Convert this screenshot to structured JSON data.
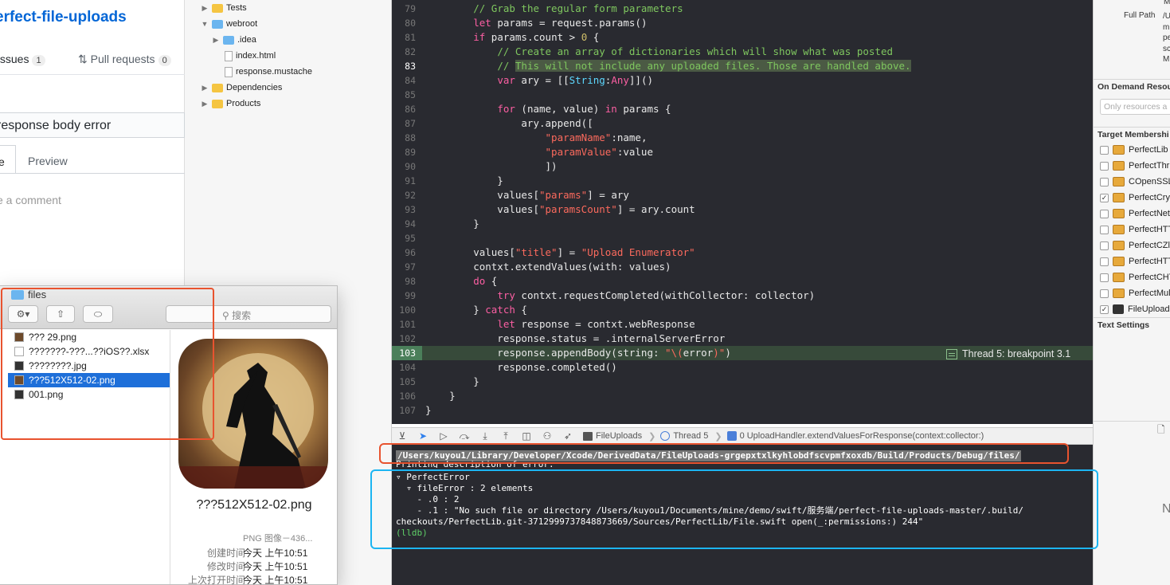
{
  "github": {
    "repo_title": "erfect-file-uploads",
    "issues_label": "Issues",
    "issues_count": "1",
    "pr_label": "Pull requests",
    "pr_count": "0",
    "issue_title": "response body error",
    "write_tab": "e",
    "preview_tab": "Preview",
    "comment_placeholder": "e a comment"
  },
  "navigator": {
    "items": [
      {
        "label": "Tests",
        "kind": "folder"
      },
      {
        "label": "webroot",
        "kind": "folder-blue"
      },
      {
        "label": ".idea",
        "kind": "folder-blue"
      },
      {
        "label": "index.html",
        "kind": "file"
      },
      {
        "label": "response.mustache",
        "kind": "file"
      },
      {
        "label": "Dependencies",
        "kind": "folder"
      },
      {
        "label": "Products",
        "kind": "folder"
      }
    ]
  },
  "editor": {
    "line_numbers": [
      "79",
      "80",
      "81",
      "82",
      "83",
      "84",
      "85",
      "86",
      "87",
      "88",
      "89",
      "90",
      "91",
      "92",
      "93",
      "94",
      "95",
      "96",
      "97",
      "98",
      "99",
      "100",
      "101",
      "102",
      "103",
      "104",
      "105",
      "106",
      "107"
    ],
    "breakpoint_label": "Thread 5: breakpoint 3.1"
  },
  "debugbar": {
    "crumb_target": "FileUploads",
    "crumb_thread": "Thread 5",
    "crumb_frame": "0 UploadHandler.extendValuesForResponse(context:collector:)"
  },
  "console": {
    "path_line": "/Users/kuyou1/Library/Developer/Xcode/DerivedData/FileUploads-grgepxtxlkyhlobdfscvpmfxoxdb/Build/Products/Debug/files/",
    "printing_line": "Printing description of error:",
    "line1": "▿ PerfectError",
    "line2": "  ▿ fileError : 2 elements",
    "line3": "    - .0 : 2",
    "line4": "    - .1 : \"No such file or directory /Users/kuyou1/Documents/mine/demo/swift/服务端/perfect-file-uploads-master/.build/",
    "line5": "checkouts/PerfectLib.git-3712999737848873669/Sources/PerfectLib/File.swift open(_:permissions:) 244\"",
    "prompt": "(lldb)"
  },
  "inspector": {
    "top_value_1": "M",
    "full_path_label": "Full Path",
    "full_path_lines": [
      "/U",
      "m",
      "pe",
      "sc",
      "M"
    ],
    "on_demand_title": "On Demand Resou",
    "on_demand_placeholder": "Only resources a",
    "target_membership_title": "Target Membershi",
    "targets": [
      {
        "label": "PerfectLib",
        "checked": false,
        "icon": "briefcase"
      },
      {
        "label": "PerfectThr",
        "checked": false,
        "icon": "briefcase"
      },
      {
        "label": "COpenSSL",
        "checked": false,
        "icon": "briefcase"
      },
      {
        "label": "PerfectCry",
        "checked": true,
        "icon": "briefcase"
      },
      {
        "label": "PerfectNet",
        "checked": false,
        "icon": "briefcase"
      },
      {
        "label": "PerfectHTT",
        "checked": false,
        "icon": "briefcase"
      },
      {
        "label": "PerfectCZl",
        "checked": false,
        "icon": "briefcase"
      },
      {
        "label": "PerfectHTT",
        "checked": false,
        "icon": "briefcase"
      },
      {
        "label": "PerfectCHT",
        "checked": false,
        "icon": "briefcase"
      },
      {
        "label": "PerfectMul",
        "checked": false,
        "icon": "briefcase"
      },
      {
        "label": "FileUpload",
        "checked": true,
        "icon": "app"
      }
    ],
    "text_settings_title": "Text Settings",
    "bottom_letter": "N"
  },
  "finder": {
    "title": "files",
    "search_placeholder": "搜索",
    "files": [
      {
        "name": "??? 29.png",
        "thumb": "img"
      },
      {
        "name": "???????-???...??iOS??.xlsx",
        "thumb": "doc"
      },
      {
        "name": "????????.jpg",
        "thumb": "dark"
      },
      {
        "name": "???512X512-02.png",
        "thumb": "img",
        "selected": true
      },
      {
        "name": "001.png",
        "thumb": "dark"
      }
    ],
    "preview_name": "???512X512-02.png",
    "preview_kind": "PNG 图像－436...",
    "meta": [
      {
        "key": "创建时间",
        "value": "今天 上午10:51"
      },
      {
        "key": "修改时间",
        "value": "今天 上午10:51"
      },
      {
        "key": "上次打开时间",
        "value": "今天 上午10:51"
      }
    ]
  },
  "colors": {
    "editor_bg": "#292a30",
    "selection_blue": "#1e6fd9",
    "annotation_red": "#e8532f",
    "annotation_cyan": "#1cb5f2",
    "link_blue": "#0366d6"
  }
}
